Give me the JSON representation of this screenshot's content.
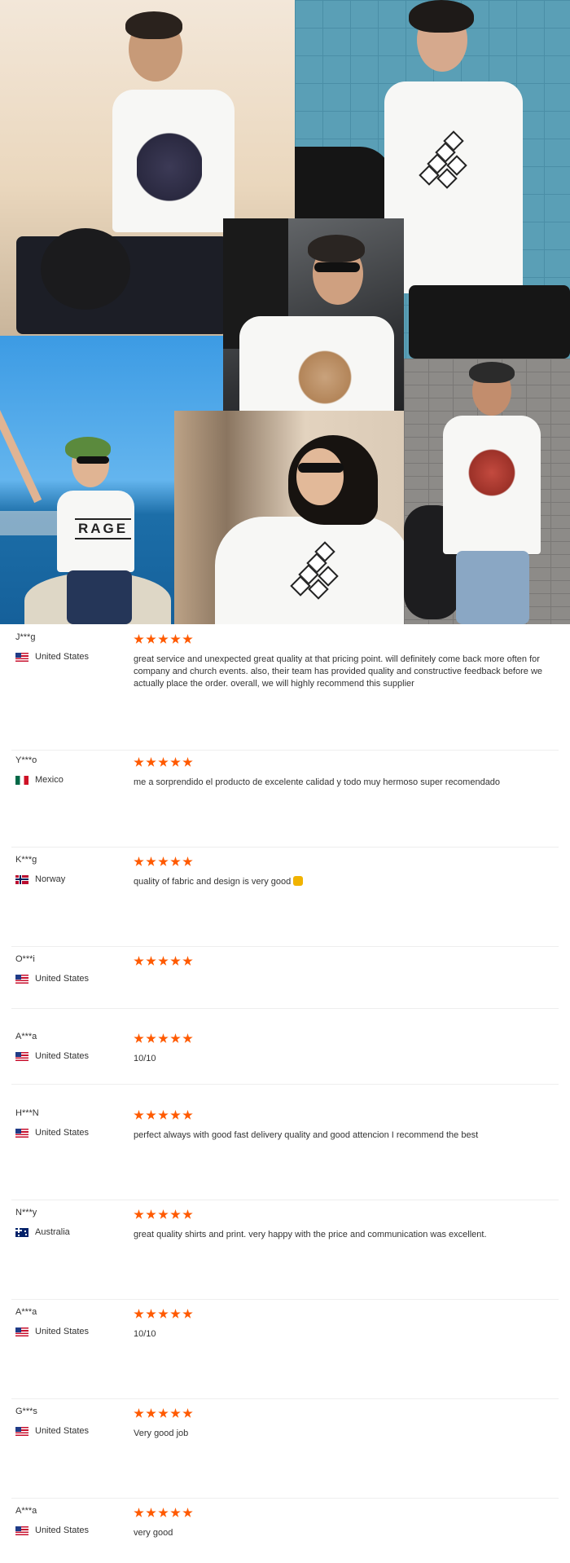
{
  "reviews": [
    {
      "user": "J***g",
      "country": "United States",
      "flag": "us",
      "stars": 5,
      "text": "great service and unexpected great quality at that pricing point. will definitely come back more often for company and church events. also, their team has provided quality and constructive feedback before we actually place the order. overall, we will highly recommend this supplier"
    },
    {
      "user": "Y***o",
      "country": "Mexico",
      "flag": "mx",
      "stars": 5,
      "text": "me a sorprendido el producto de excelente calidad y todo muy hermoso super recomendado"
    },
    {
      "user": "K***g",
      "country": "Norway",
      "flag": "no",
      "stars": 5,
      "text": "quality of fabric and design is very good"
    },
    {
      "user": "O***i",
      "country": "United States",
      "flag": "us",
      "stars": 5,
      "text": ""
    },
    {
      "user": "A***a",
      "country": "United States",
      "flag": "us",
      "stars": 5,
      "text": "10/10"
    },
    {
      "user": "H***N",
      "country": "United States",
      "flag": "us",
      "stars": 5,
      "text": "perfect always with good fast delivery quality and good attencion I recommend the best"
    },
    {
      "user": "N***y",
      "country": "Australia",
      "flag": "au",
      "stars": 5,
      "text": "great quality shirts and print. very happy with the price and communication was excellent."
    },
    {
      "user": "A***a",
      "country": "United States",
      "flag": "us",
      "stars": 5,
      "text": "10/10"
    },
    {
      "user": "G***s",
      "country": "United States",
      "flag": "us",
      "stars": 5,
      "text": "Very good job"
    },
    {
      "user": "A***a",
      "country": "United States",
      "flag": "us",
      "stars": 5,
      "text": "very good"
    }
  ],
  "graphics": {
    "rage": "RAGE"
  },
  "colors": {
    "star": "#ff5a00",
    "divider": "#eeeeee"
  }
}
